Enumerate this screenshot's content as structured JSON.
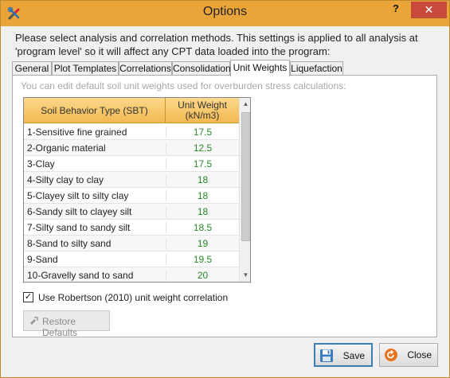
{
  "window": {
    "title": "Options",
    "help_label": "?",
    "close_label": "✕",
    "titlebar_color": "#e9a53a"
  },
  "intro_text": "Please select analysis and correlation methods. This settings is applied to all analysis at 'program level' so it will affect any CPT data loaded into the program:",
  "tabs": [
    {
      "label": "General",
      "active": false
    },
    {
      "label": "Plot Templates",
      "active": false
    },
    {
      "label": "Correlations",
      "active": false
    },
    {
      "label": "Consolidation",
      "active": false
    },
    {
      "label": "Unit Weights",
      "active": true
    },
    {
      "label": "Liquefaction",
      "active": false
    }
  ],
  "unit_weights": {
    "hint": "You can edit default soil unit weights used for overburden stress calculations:",
    "columns": [
      "Soil Behavior Type (SBT)",
      "Unit Weight\n(kN/m3)"
    ],
    "rows": [
      {
        "sbt": "1-Sensitive fine grained",
        "weight": "17.5"
      },
      {
        "sbt": "2-Organic material",
        "weight": "12.5"
      },
      {
        "sbt": "3-Clay",
        "weight": "17.5"
      },
      {
        "sbt": "4-Silty clay to clay",
        "weight": "18"
      },
      {
        "sbt": "5-Clayey silt to silty clay",
        "weight": "18"
      },
      {
        "sbt": "6-Sandy silt to clayey silt",
        "weight": "18"
      },
      {
        "sbt": "7-Silty sand to sandy silt",
        "weight": "18.5"
      },
      {
        "sbt": "8-Sand to silty sand",
        "weight": "19"
      },
      {
        "sbt": "9-Sand",
        "weight": "19.5"
      },
      {
        "sbt": "10-Gravelly sand to sand",
        "weight": "20"
      }
    ],
    "value_color": "#2a8a2a",
    "checkbox_label": "Use Robertson (2010) unit weight correlation",
    "checkbox_checked": true,
    "restore_label": "Restore Defaults"
  },
  "footer": {
    "save_label": "Save",
    "close_label": "Close"
  }
}
